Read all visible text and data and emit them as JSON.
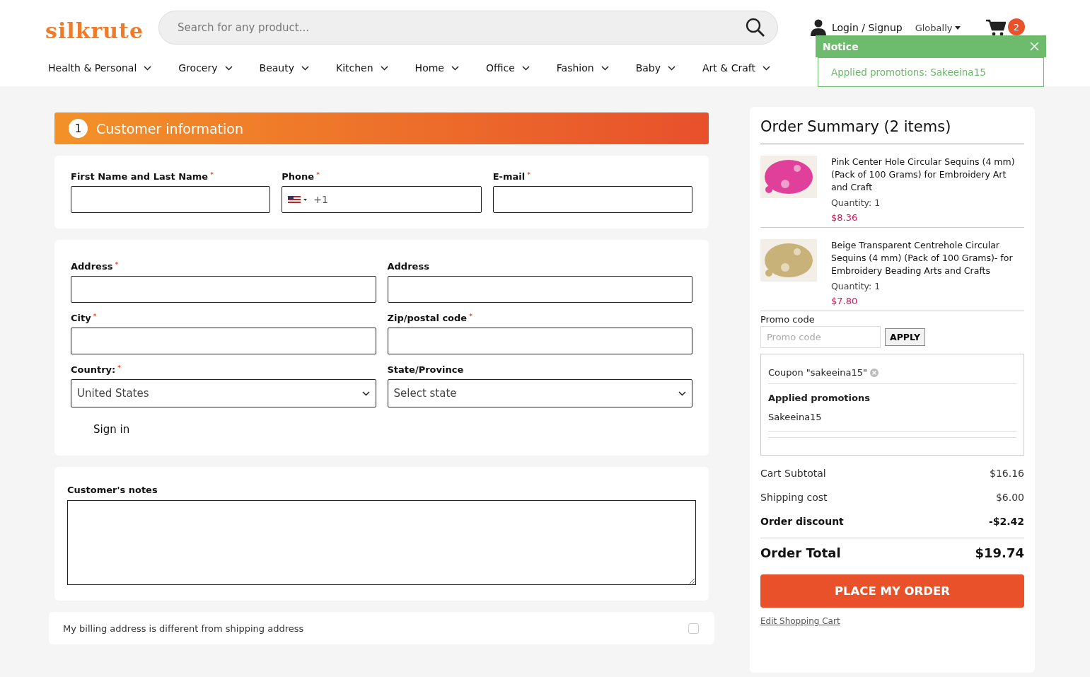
{
  "header": {
    "logo": "silkrute",
    "search": {
      "placeholder": "Search for any product..."
    },
    "login": "Login / Signup",
    "region": "Globally",
    "cart_count": "2"
  },
  "nav": [
    "Health & Personal",
    "Grocery",
    "Beauty",
    "Kitchen",
    "Home",
    "Office",
    "Fashion",
    "Baby",
    "Art & Craft"
  ],
  "notice": {
    "title": "Notice",
    "message": "Applied promotions: Sakeeina15"
  },
  "step": {
    "number": "1",
    "title": "Customer information"
  },
  "contact_fields": [
    {
      "label": "First Name and Last Name",
      "required_mark": "*",
      "kind": "text"
    },
    {
      "label": "Phone",
      "required_mark": "*",
      "kind": "phone",
      "value": "+1"
    },
    {
      "label": "E-mail",
      "required_mark": "*",
      "kind": "text"
    }
  ],
  "address_fields": [
    {
      "label": "Address",
      "required_mark": "*",
      "kind": "text"
    },
    {
      "label": "Address",
      "kind": "text"
    },
    {
      "label": "City",
      "required_mark": "*",
      "kind": "text"
    },
    {
      "label": "Zip/postal code",
      "required_mark": "*",
      "kind": "text"
    },
    {
      "label": "Country:",
      "required_mark": "*",
      "kind": "select",
      "value": "United States"
    },
    {
      "label": "State/Province",
      "kind": "select",
      "value": "Select state"
    }
  ],
  "sign_in": "Sign in",
  "notes": {
    "label": "Customer's notes"
  },
  "billing": {
    "label": "My billing address is different from shipping address",
    "checked": false
  },
  "summary": {
    "title": "Order Summary (2 items)",
    "items": [
      {
        "name": "Pink Center Hole Circular Sequins (4 mm) (Pack of 100 Grams) for Embroidery Art and Craft",
        "quantity": "Quantity: 1",
        "price": "$8.36"
      },
      {
        "name": "Beige Transparent Centrehole Circular Sequins (4 mm) (Pack of 100 Grams)- for Embroidery Beading Arts and Crafts",
        "quantity": "Quantity: 1",
        "price": "$7.80"
      }
    ],
    "promo": {
      "label": "Promo code",
      "placeholder": "Promo code",
      "button": "APPLY"
    },
    "coupon": "Coupon \"sakeeina15\"",
    "applied_title": "Applied promotions",
    "applied": "Sakeeina15",
    "totals": [
      {
        "label": "Cart Subtotal",
        "value": "$16.16",
        "bold": false
      },
      {
        "label": "Shipping cost",
        "value": "$6.00",
        "bold": false
      },
      {
        "label": "Order discount",
        "value": "-$2.42",
        "bold": true
      }
    ],
    "total": {
      "label": "Order Total",
      "value": "$19.74"
    },
    "order_button": "PLACE MY ORDER",
    "edit_link": "Edit Shopping Cart"
  }
}
